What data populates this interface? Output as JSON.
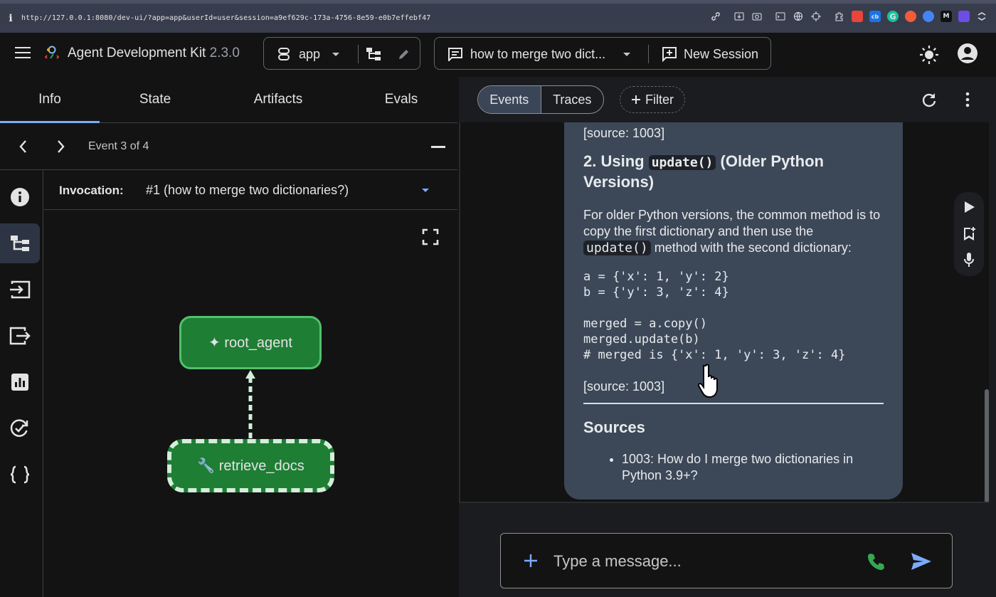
{
  "browser": {
    "info_glyph": "i",
    "url": "http://127.0.0.1:8080/dev-ui/?app=app&userId=user&session=a9ef629c-173a-4756-8e59-e0b7effebf47",
    "extensions": [
      "link-icon",
      "save-icon",
      "camera-icon",
      "terminal-icon",
      "globe-icon",
      "crosshair-icon",
      "extension-icon",
      "red-ext-icon",
      "blue-ext-icon",
      "grammarly-icon",
      "orange-ext-icon",
      "settings-ext-icon",
      "medium-icon",
      "purple-ext-icon",
      "grid-ext-icon"
    ]
  },
  "header": {
    "title": "Agent Development Kit",
    "version": "2.3.0",
    "app_name": "app",
    "session_title": "how to merge two dict...",
    "new_session_label": "New Session"
  },
  "left": {
    "tabs": [
      "Info",
      "State",
      "Artifacts",
      "Evals"
    ],
    "active_tab": "Info",
    "event_label": "Event 3 of 4",
    "invocation_key": "Invocation:",
    "invocation_value": "#1 (how to merge two dictionaries?)",
    "graph": {
      "root_node": "✦ root_agent",
      "tool_node": "🔧 retrieve_docs"
    },
    "rail_icons": [
      "info-icon",
      "graph-icon",
      "input-icon",
      "output-icon",
      "chart-icon",
      "eval-icon",
      "json-icon"
    ]
  },
  "right": {
    "events_label": "Events",
    "traces_label": "Traces",
    "filter_label": "Filter",
    "message": {
      "source_top": "[source: 1003]",
      "heading_num": "2. Using ",
      "heading_code": "update()",
      "heading_rest": " (Older Python Versions)",
      "para_a": "For older Python versions, the common method is to copy the first dictionary and then use the ",
      "para_code": "update()",
      "para_b": " method with the second dictionary:",
      "code_block": "a = {'x': 1, 'y': 2}\nb = {'y': 3, 'z': 4}\n\nmerged = a.copy()\nmerged.update(b)\n# merged is {'x': 1, 'y': 3, 'z': 4}",
      "source_bottom": "[source: 1003]",
      "sources_heading": "Sources",
      "sources": [
        "1003: How do I merge two dictionaries in Python 3.9+?"
      ]
    },
    "composer_placeholder": "Type a message..."
  },
  "colors": {
    "accent_blue": "#7cacf8",
    "node_green": "#1e7e34",
    "bubble": "#3c4858"
  }
}
